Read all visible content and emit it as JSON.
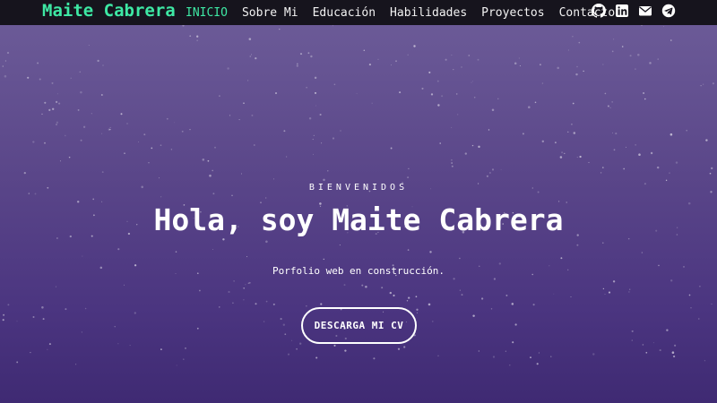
{
  "navbar": {
    "brand": "Maite Cabrera",
    "links": [
      "INICIO",
      "Sobre Mi",
      "Educación",
      "Habilidades",
      "Proyectos",
      "Contacto"
    ],
    "active_link": "INICIO",
    "social_icons": [
      "github-icon",
      "linkedin-icon",
      "envelope-icon",
      "telegram-icon"
    ]
  },
  "hero": {
    "welcome": "BIENVENIDOS",
    "headline": "Hola, soy Maite Cabrera",
    "subtitle": "Porfolio web en construcción.",
    "cta_label": "DESCARGA MI CV"
  },
  "colors": {
    "accent": "#3ee8a4",
    "navbar_bg": "#16141d",
    "hero_top": "#6b5a97",
    "hero_bottom": "#3f2a73",
    "text": "#ffffff"
  }
}
